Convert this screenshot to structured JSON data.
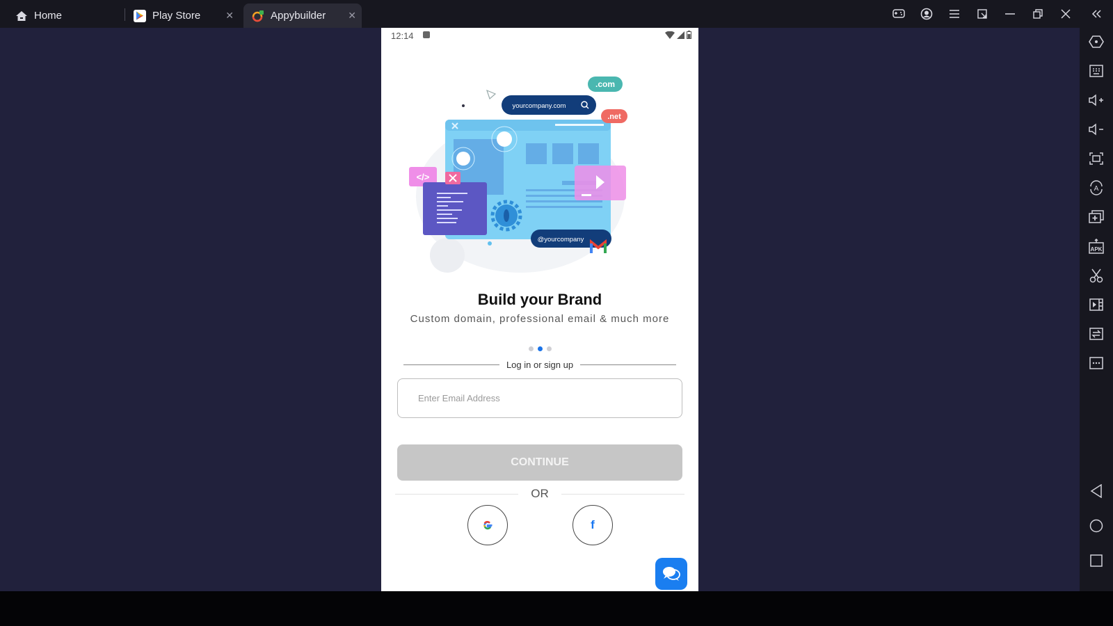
{
  "titlebar": {
    "tabs": [
      {
        "label": "Home",
        "icon": "home-icon",
        "closable": false
      },
      {
        "label": "Play Store",
        "icon": "play-store-icon",
        "closable": true
      },
      {
        "label": "Appybuilder",
        "icon": "appybuilder-icon",
        "closable": true,
        "active": true
      }
    ],
    "controls": [
      "gamepad-icon",
      "account-icon",
      "menu-icon",
      "resize-icon",
      "minimize-icon",
      "restore-icon",
      "close-icon",
      "collapse-sidebar-icon"
    ]
  },
  "sidebar": {
    "tools": [
      {
        "name": "settings"
      },
      {
        "name": "keyboard"
      },
      {
        "name": "volume-up"
      },
      {
        "name": "volume-down"
      },
      {
        "name": "fullscreen"
      },
      {
        "name": "rotate"
      },
      {
        "name": "multi-instance"
      },
      {
        "name": "install-apk"
      },
      {
        "name": "screenshot"
      },
      {
        "name": "record"
      },
      {
        "name": "sync"
      },
      {
        "name": "more"
      }
    ],
    "nav": [
      "back",
      "home",
      "recents"
    ]
  },
  "phone": {
    "status": {
      "time": "12:14"
    },
    "illustration": {
      "domain_search": "yourcompany.com",
      "badge_com": ".com",
      "badge_net": ".net",
      "email_pill": "@yourcompany"
    },
    "headline": "Build your Brand",
    "subheadline": "Custom domain, professional email & much more",
    "carousel": {
      "count": 3,
      "active": 2
    },
    "login_divider": "Log in or sign up",
    "email_field": {
      "placeholder": "Enter Email Address",
      "value": ""
    },
    "continue_label": "CONTINUE",
    "or_label": "OR",
    "social": {
      "google": "G",
      "facebook": "f"
    }
  },
  "colors": {
    "accent": "#1a73e8",
    "button_disabled": "#c6c6c6",
    "desktop_bg": "#21213c",
    "titlebar_bg": "#17171f"
  }
}
